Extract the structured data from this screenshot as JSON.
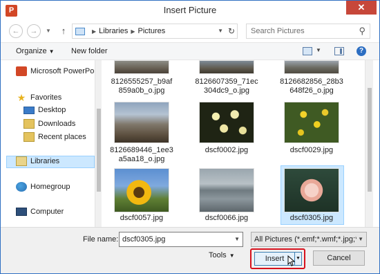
{
  "window": {
    "title": "Insert Picture",
    "app_icon_glyph": "P",
    "close_glyph": "✕"
  },
  "nav": {
    "back_glyph": "←",
    "forward_glyph": "→",
    "up_glyph": "↑",
    "breadcrumb": [
      "Libraries",
      "Pictures"
    ],
    "search_placeholder": "Search Pictures"
  },
  "toolbar": {
    "organize_label": "Organize",
    "new_folder_label": "New folder",
    "help_glyph": "?"
  },
  "sidebar": {
    "items": [
      {
        "label": "Microsoft PowerPoint",
        "icon": "powerpoint-icon"
      },
      {
        "label": "Favorites",
        "icon": "star-icon"
      },
      {
        "label": "Desktop",
        "icon": "desktop-icon"
      },
      {
        "label": "Downloads",
        "icon": "downloads-icon"
      },
      {
        "label": "Recent places",
        "icon": "recent-places-icon"
      },
      {
        "label": "Libraries",
        "icon": "libraries-icon",
        "selected": true
      },
      {
        "label": "Homegroup",
        "icon": "homegroup-icon"
      },
      {
        "label": "Computer",
        "icon": "computer-icon"
      }
    ]
  },
  "files": {
    "top_row": [
      {
        "name": "8126555257_b9af859a0b_o.jpg",
        "line1": "8126555257_b9af",
        "line2": "859a0b_o.jpg"
      },
      {
        "name": "8126607359_71ec304dc9_o.jpg",
        "line1": "8126607359_71ec",
        "line2": "304dc9_o.jpg"
      },
      {
        "name": "8126682856_28b3648f26_o.jpg",
        "line1": "8126682856_28b3",
        "line2": "648f26_o.jpg"
      }
    ],
    "middle_row": [
      {
        "name": "8126689446_1ee3a5aa18_o.jpg",
        "line1": "8126689446_1ee3",
        "line2": "a5aa18_o.jpg"
      },
      {
        "name": "dscf0002.jpg",
        "line1": "dscf0002.jpg",
        "line2": ""
      },
      {
        "name": "dscf0029.jpg",
        "line1": "dscf0029.jpg",
        "line2": ""
      }
    ],
    "bottom_row": [
      {
        "name": "dscf0057.jpg",
        "line1": "dscf0057.jpg",
        "line2": ""
      },
      {
        "name": "dscf0066.jpg",
        "line1": "dscf0066.jpg",
        "line2": ""
      },
      {
        "name": "dscf0305.jpg",
        "line1": "dscf0305.jpg",
        "line2": "",
        "selected": true
      }
    ]
  },
  "footer": {
    "file_name_label": "File name:",
    "file_name_value": "dscf0305.jpg",
    "filter_value": "All Pictures (*.emf;*.wmf;*.jpg;*",
    "tools_label": "Tools",
    "insert_label": "Insert",
    "cancel_label": "Cancel"
  },
  "colors": {
    "accent": "#2f6fc2",
    "close_button": "#c7473a",
    "highlight_box": "#d6101c",
    "selection": "#cce8ff"
  }
}
